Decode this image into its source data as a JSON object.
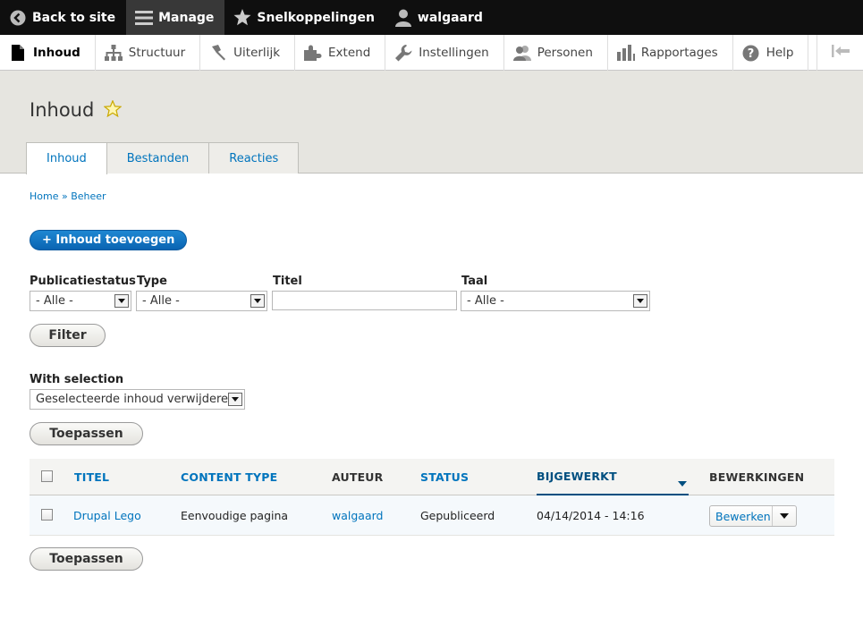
{
  "toolbar": {
    "back": "Back to site",
    "manage": "Manage",
    "shortcuts": "Snelkoppelingen",
    "user": "walgaard"
  },
  "tray": [
    {
      "label": "Inhoud",
      "icon": "file-icon"
    },
    {
      "label": "Structuur",
      "icon": "structure-icon"
    },
    {
      "label": "Uiterlijk",
      "icon": "paintbrush-icon"
    },
    {
      "label": "Extend",
      "icon": "puzzle-icon"
    },
    {
      "label": "Instellingen",
      "icon": "wrench-icon"
    },
    {
      "label": "Personen",
      "icon": "people-icon"
    },
    {
      "label": "Rapportages",
      "icon": "bar-chart-icon"
    },
    {
      "label": "Help",
      "icon": "help-icon"
    }
  ],
  "page": {
    "title": "Inhoud",
    "tabs": [
      "Inhoud",
      "Bestanden",
      "Reacties"
    ],
    "breadcrumb": {
      "home": "Home",
      "sep": "»",
      "current": "Beheer"
    },
    "add_button": "+ Inhoud toevoegen"
  },
  "filters": {
    "status_label": "Publicatiestatus",
    "status_value": "- Alle -",
    "type_label": "Type",
    "type_value": "- Alle -",
    "title_label": "Titel",
    "title_value": "",
    "lang_label": "Taal",
    "lang_value": "- Alle -",
    "filter_button": "Filter"
  },
  "bulk": {
    "label": "With selection",
    "value": "Geselecteerde inhoud verwijderen",
    "apply_button": "Toepassen"
  },
  "table": {
    "headers": {
      "title": "TITEL",
      "type": "CONTENT TYPE",
      "author": "AUTEUR",
      "status": "STATUS",
      "updated": "BIJGEWERKT",
      "ops": "BEWERKINGEN"
    },
    "rows": [
      {
        "title": "Drupal Lego",
        "type": "Eenvoudige pagina",
        "author": "walgaard",
        "status": "Gepubliceerd",
        "updated": "04/14/2014 - 14:16",
        "op": "Bewerken"
      }
    ]
  },
  "colors": {
    "link": "#0074bd",
    "toolbar": "#0f0f0f",
    "header_bg": "#e6e5e0"
  }
}
